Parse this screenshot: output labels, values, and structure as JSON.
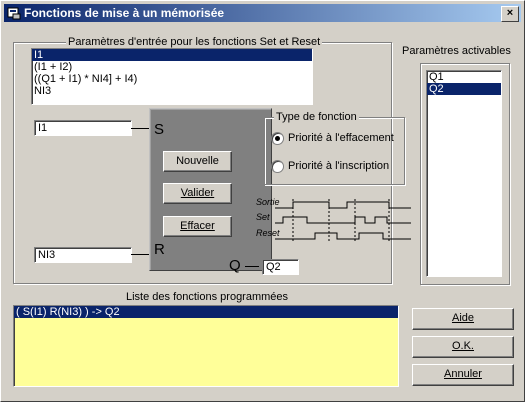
{
  "window": {
    "title": "Fonctions de mise à un mémorisée",
    "close": "×"
  },
  "inputs": {
    "title": "Paramètres d'entrée pour les fonctions Set et Reset",
    "items": [
      "I1",
      "(I1 + I2)",
      "((Q1 + I1) * NI4] + I4)",
      "NI3"
    ],
    "selected_index": 0
  },
  "activatable": {
    "title": "Paramètres activables",
    "items": [
      "Q1",
      "Q2"
    ],
    "selected_index": 1
  },
  "block": {
    "s_value": "I1",
    "r_value": "NI3",
    "q_value": "Q2",
    "s_label": "S",
    "r_label": "R",
    "q_label": "Q",
    "btn_new": "Nouvelle",
    "btn_validate": "Valider",
    "btn_delete": "Effacer"
  },
  "type": {
    "title": "Type de fonction",
    "opt1": "Priorité à l'effacement",
    "opt2": "Priorité à l'inscription",
    "selected": 1
  },
  "timing": {
    "sortie": "Sortie",
    "set": "Set",
    "reset": "Reset"
  },
  "programmed": {
    "title": "Liste des fonctions programmées",
    "items": [
      "( S(I1) R(NI3) ) -> Q2"
    ]
  },
  "buttons": {
    "help": "Aide",
    "ok": "O.K.",
    "cancel": "Annuler"
  },
  "colors": {
    "title_start": "#0a246a",
    "title_end": "#a6caf0",
    "block_fill": "#808080",
    "list_yellow": "#ffff99",
    "selection": "#0a246a"
  }
}
